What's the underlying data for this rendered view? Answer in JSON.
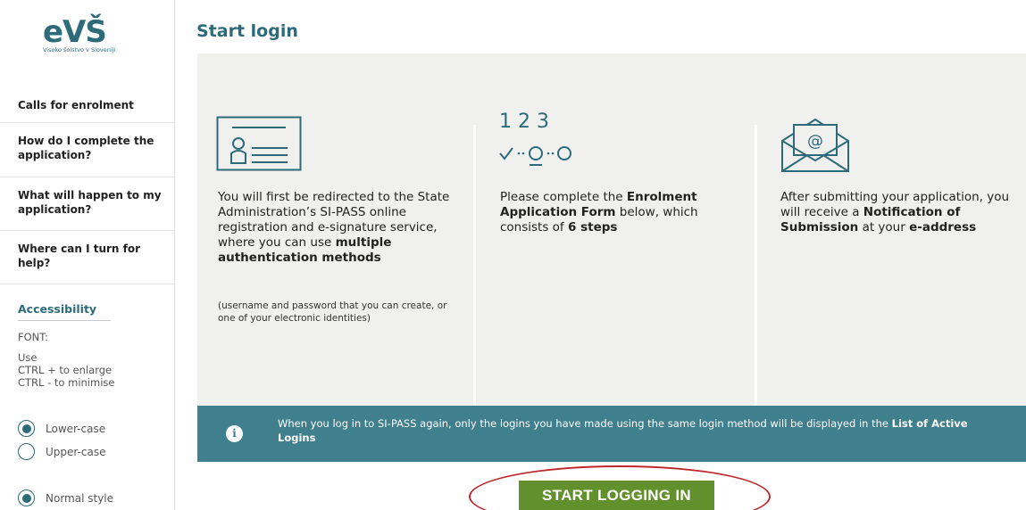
{
  "logo": {
    "mark": "eVŠ",
    "tagline": "Visoko šolstvo v Sloveniji"
  },
  "sidebar": {
    "items": [
      {
        "label": "Calls for enrolment"
      },
      {
        "label": "How do I complete the application?"
      },
      {
        "label": "What will happen to my application?"
      },
      {
        "label": "Where can I turn for help?"
      }
    ],
    "accessibility": {
      "title": "Accessibility",
      "font_label": "FONT:",
      "help_line1": "Use",
      "help_line2": "CTRL + to enlarge",
      "help_line3": "CTRL - to minimise",
      "case_options": [
        {
          "label": "Lower-case",
          "selected": true
        },
        {
          "label": "Upper-case",
          "selected": false
        }
      ],
      "style_options": [
        {
          "label": "Normal style",
          "selected": true
        }
      ]
    }
  },
  "main": {
    "title": "Start login",
    "columns": [
      {
        "icon": "id-card-icon",
        "text_pre": "You will first be redirected to the State Administration’s SI-PASS online registration and e-signature service, where you can use ",
        "text_bold": "multiple authentication methods",
        "note": "(username and password that you can create, or one of your electronic identities)"
      },
      {
        "icon": "steps-icon",
        "steps_numbers": "1  2  3",
        "text_pre": "Please complete the ",
        "text_bold1": "Enrolment Application Form",
        "text_mid": " below, which consists of ",
        "text_bold2": "6 steps"
      },
      {
        "icon": "envelope-at-icon",
        "text_pre": "After submitting your application, you will receive a ",
        "text_bold1": "Notification of Submission",
        "text_mid": " at your ",
        "text_bold2": "e-address"
      }
    ],
    "info": {
      "icon": "info-icon",
      "icon_glyph": "i",
      "text_pre": "When you log in to SI-PASS again, only the logins you have made using the same login method will be displayed in the ",
      "text_bold": "List of Active Logins"
    },
    "cta_label": "START LOGGING IN"
  },
  "colors": {
    "accent": "#2e6b7a",
    "info_bar": "#3f7f8e",
    "cta": "#62902d",
    "highlight": "#c0272d"
  }
}
